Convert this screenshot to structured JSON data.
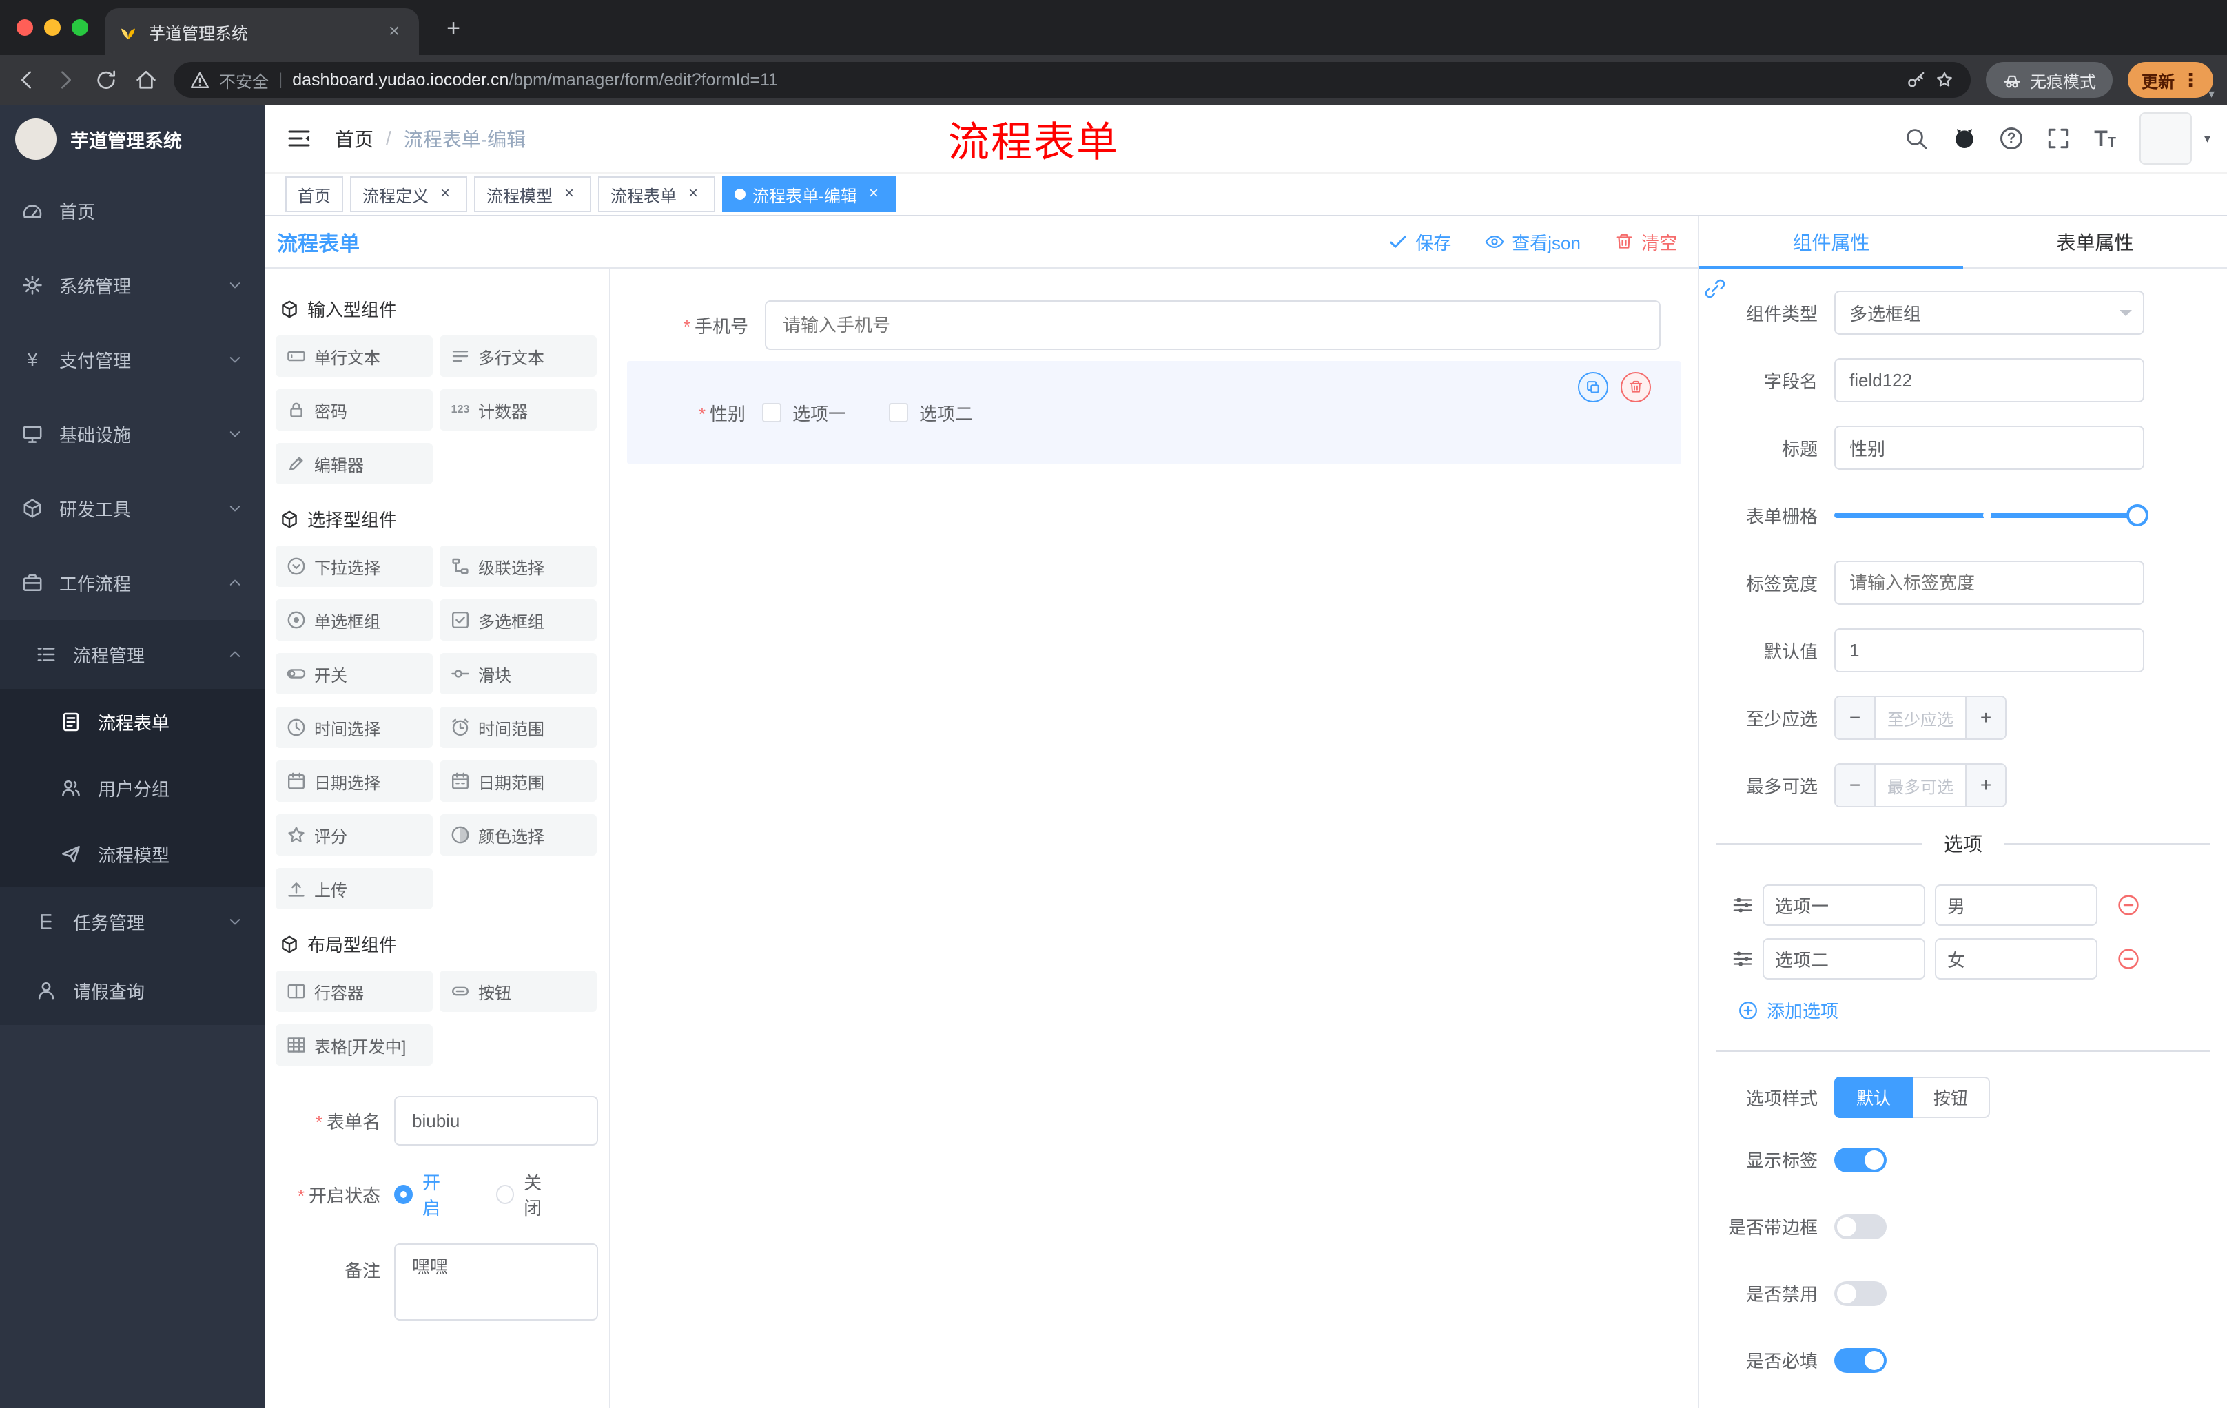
{
  "browser": {
    "tab_title": "芋道管理系统",
    "security_label": "不安全",
    "url_domain": "dashboard.yudao.iocoder.cn",
    "url_path": "/bpm/manager/form/edit?formId=11",
    "incognito_label": "无痕模式",
    "update_label": "更新"
  },
  "sidebar": {
    "logo_title": "芋道管理系统",
    "home": "首页",
    "system": "系统管理",
    "payment": "支付管理",
    "infra": "基础设施",
    "devtools": "研发工具",
    "workflow": "工作流程",
    "process_mgmt": "流程管理",
    "process_form": "流程表单",
    "user_group": "用户分组",
    "process_model": "流程模型",
    "task_mgmt": "任务管理",
    "leave_query": "请假查询"
  },
  "navbar": {
    "breadcrumb_home": "首页",
    "breadcrumb_current": "流程表单-编辑",
    "annotation": "流程表单"
  },
  "tags": [
    {
      "label": "首页"
    },
    {
      "label": "流程定义"
    },
    {
      "label": "流程模型"
    },
    {
      "label": "流程表单"
    },
    {
      "label": "流程表单-编辑"
    }
  ],
  "designer": {
    "title": "流程表单",
    "save": "保存",
    "view_json": "查看json",
    "clear": "清空",
    "palette": {
      "s1": {
        "title": "输入型组件",
        "items": [
          "单行文本",
          "多行文本",
          "密码",
          "计数器",
          "编辑器"
        ]
      },
      "s2": {
        "title": "选择型组件",
        "items": [
          "下拉选择",
          "级联选择",
          "单选框组",
          "多选框组",
          "开关",
          "滑块",
          "时间选择",
          "时间范围",
          "日期选择",
          "日期范围",
          "评分",
          "颜色选择",
          "上传"
        ]
      },
      "s3": {
        "title": "布局型组件",
        "items": [
          "行容器",
          "按钮",
          "表格[开发中]"
        ]
      }
    },
    "meta": {
      "form_name_label": "表单名",
      "form_name_value": "biubiu",
      "status_label": "开启状态",
      "status_on": "开启",
      "status_off": "关闭",
      "remark_label": "备注",
      "remark_value": "嘿嘿"
    },
    "canvas": {
      "phone_label": "手机号",
      "phone_placeholder": "请输入手机号",
      "gender_label": "性别",
      "option1": "选项一",
      "option2": "选项二"
    }
  },
  "props": {
    "tab_component": "组件属性",
    "tab_form": "表单属性",
    "component_type_label": "组件类型",
    "component_type_value": "多选框组",
    "field_name_label": "字段名",
    "field_name_value": "field122",
    "title_label": "标题",
    "title_value": "性别",
    "grid_label": "表单栅格",
    "label_width_label": "标签宽度",
    "label_width_placeholder": "请输入标签宽度",
    "default_label": "默认值",
    "default_value": "1",
    "min_label": "至少应选",
    "min_placeholder": "至少应选",
    "max_label": "最多可选",
    "max_placeholder": "最多可选",
    "options_title": "选项",
    "options": [
      {
        "label": "选项一",
        "value": "男"
      },
      {
        "label": "选项二",
        "value": "女"
      }
    ],
    "add_option": "添加选项",
    "style_label": "选项样式",
    "style_default": "默认",
    "style_button": "按钮",
    "toggle_show_label": "显示标签",
    "toggle_border": "是否带边框",
    "toggle_disabled": "是否禁用",
    "toggle_required": "是否必填"
  },
  "colors": {
    "accent": "#409eff",
    "danger": "#f56c6c",
    "annotation_red": "#fe0100",
    "sidebar_bg": "#2d3442"
  }
}
